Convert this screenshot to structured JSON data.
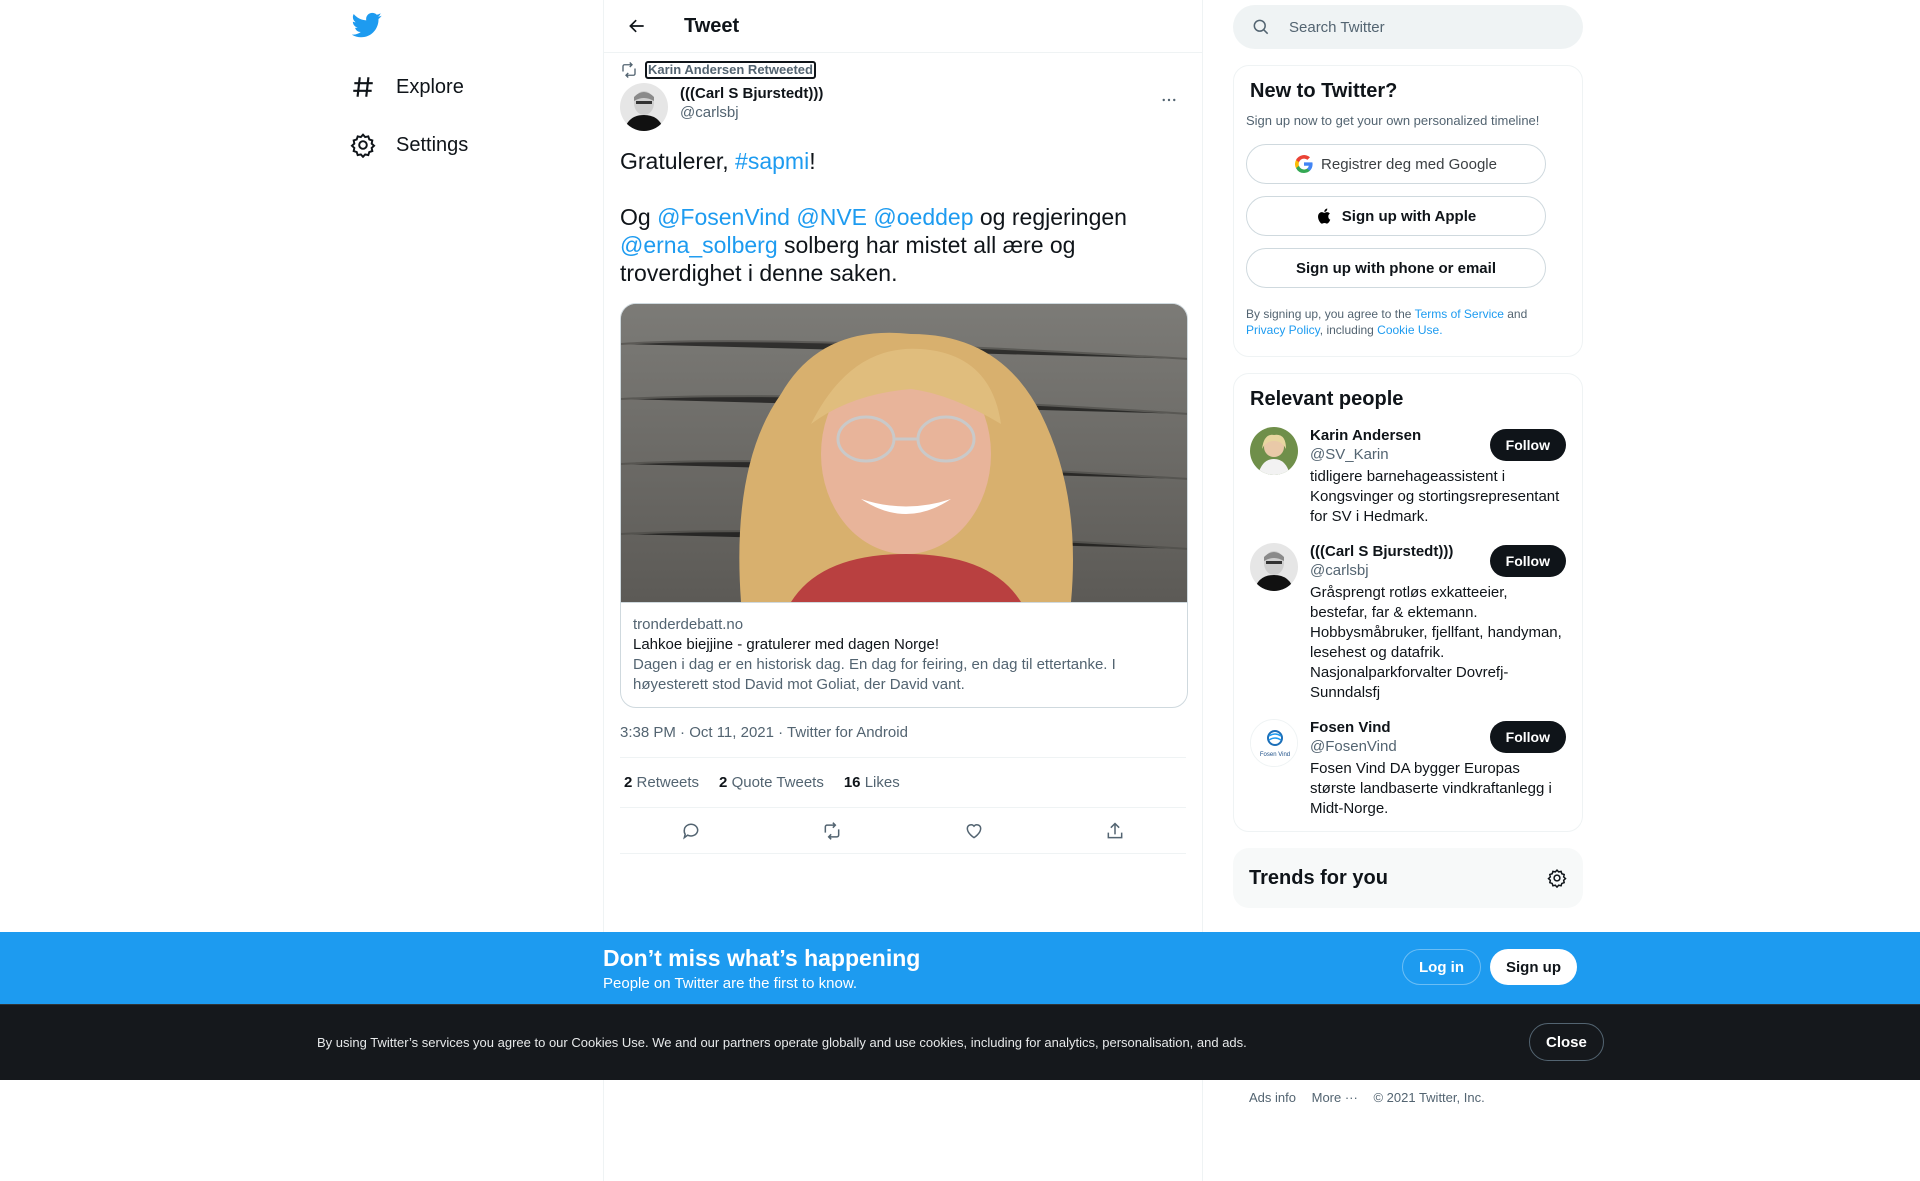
{
  "colors": {
    "accent": "#1d9bf0",
    "text": "#0f1419",
    "muted": "#536471",
    "dark_bar": "#15181c"
  },
  "sidebar": {
    "logo": "twitter-bird-icon",
    "items": [
      {
        "label": "Explore",
        "icon": "hashtag-icon"
      },
      {
        "label": "Settings",
        "icon": "gear-icon"
      }
    ]
  },
  "main": {
    "header_title": "Tweet",
    "tweet": {
      "social_context": "Karin Andersen Retweeted",
      "author_name": "(((Carl S Bjurstedt)))",
      "author_handle": "@carlsbj",
      "text": {
        "line1_prefix": "Gratulerer, ",
        "line1_tag": "#sapmi",
        "line1_suffix": "!",
        "line2_og": "Og ",
        "mention1": "@FosenVind",
        "mention2": "@NVE",
        "mention3": "@oeddep",
        "line2_rest": " og regjeringen ",
        "mention4": "@erna_solberg",
        "line2_end": " solberg har mistet all ære og troverdighet i denne saken."
      },
      "card": {
        "domain": "tronderdebatt.no",
        "title": "Lahkoe biejjine - gratulerer med dagen Norge!",
        "description": "Dagen i dag er en historisk dag. En dag for feiring, en dag til ettertanke. I høyesterett stod David mot Goliat, der David vant."
      },
      "meta": "3:38 PM · Oct 11, 2021 · Twitter for Android",
      "stats": {
        "retweets_count": "2",
        "retweets_label": "Retweets",
        "quotes_count": "2",
        "quotes_label": "Quote Tweets",
        "likes_count": "16",
        "likes_label": "Likes"
      }
    }
  },
  "right": {
    "search_placeholder": "Search Twitter",
    "new_to_twitter": {
      "title": "New to Twitter?",
      "subtitle": "Sign up now to get your own personalized timeline!",
      "google_label": "Registrer deg med Google",
      "apple_label": "Sign up with Apple",
      "phone_label": "Sign up with phone or email",
      "legal_prefix": "By signing up, you agree to the ",
      "terms": "Terms of Service",
      "legal_and": " and ",
      "privacy": "Privacy Policy",
      "legal_including": ", including ",
      "cookie": "Cookie Use."
    },
    "relevant_people": {
      "title": "Relevant people",
      "follow_label": "Follow",
      "people": [
        {
          "name": "Karin Andersen",
          "handle": "@SV_Karin",
          "bio": "tidligere barnehageassistent i Kongsvinger og stortingsrepresentant for SV i Hedmark."
        },
        {
          "name": "(((Carl S Bjurstedt)))",
          "handle": "@carlsbj",
          "bio": "Gråsprengt rotløs exkatteeier, bestefar, far & ektemann. Hobbysmåbruker, fjellfant, handyman, lesehest og datafrik. Nasjonalparkforvalter Dovrefj-Sunndalsfj"
        },
        {
          "name": "Fosen Vind",
          "handle": "@FosenVind",
          "bio": "Fosen Vind DA bygger Europas største landbaserte vindkraftanlegg i Midt-Norge.",
          "avatar_text": "Fosen Vind"
        }
      ]
    },
    "trends_title": "Trends for you",
    "footer": {
      "ads": "Ads info",
      "more": "More ···",
      "copyright": "© 2021 Twitter, Inc."
    }
  },
  "bottom_bar": {
    "title": "Don’t miss what’s happening",
    "subtitle": "People on Twitter are the first to know.",
    "login": "Log in",
    "signup": "Sign up"
  },
  "cookie_bar": {
    "text": "By using Twitter’s services you agree to our Cookies Use. We and our partners operate globally and use cookies, including for analytics, personalisation, and ads.",
    "close": "Close"
  }
}
